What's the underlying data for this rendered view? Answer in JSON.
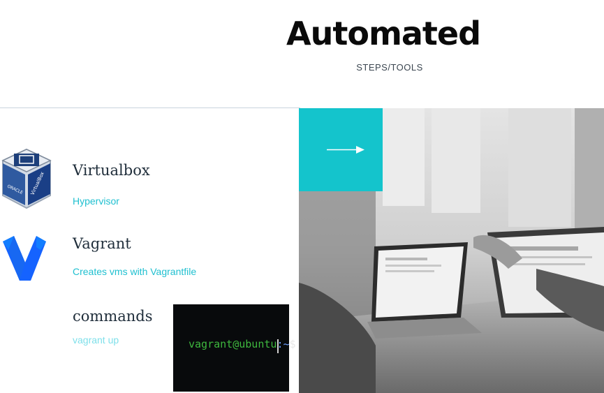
{
  "header": {
    "title": "Automated",
    "subtitle": "STEPS/TOOLS"
  },
  "items": [
    {
      "title": "Virtualbox",
      "description": "Hypervisor",
      "icon": "virtualbox-icon"
    },
    {
      "title": "Vagrant",
      "description": "Creates vms with Vagrantfile",
      "icon": "vagrant-icon"
    },
    {
      "title": "commands",
      "description": "vagrant up",
      "icon": "terminal-screenshot"
    }
  ],
  "terminal": {
    "user_host": "vagrant@ubuntu",
    "path": ":~",
    "prompt": "$"
  },
  "colors": {
    "accent": "#14c4cc",
    "link_text": "#20c0d0",
    "heading": "#1f2d3a"
  }
}
